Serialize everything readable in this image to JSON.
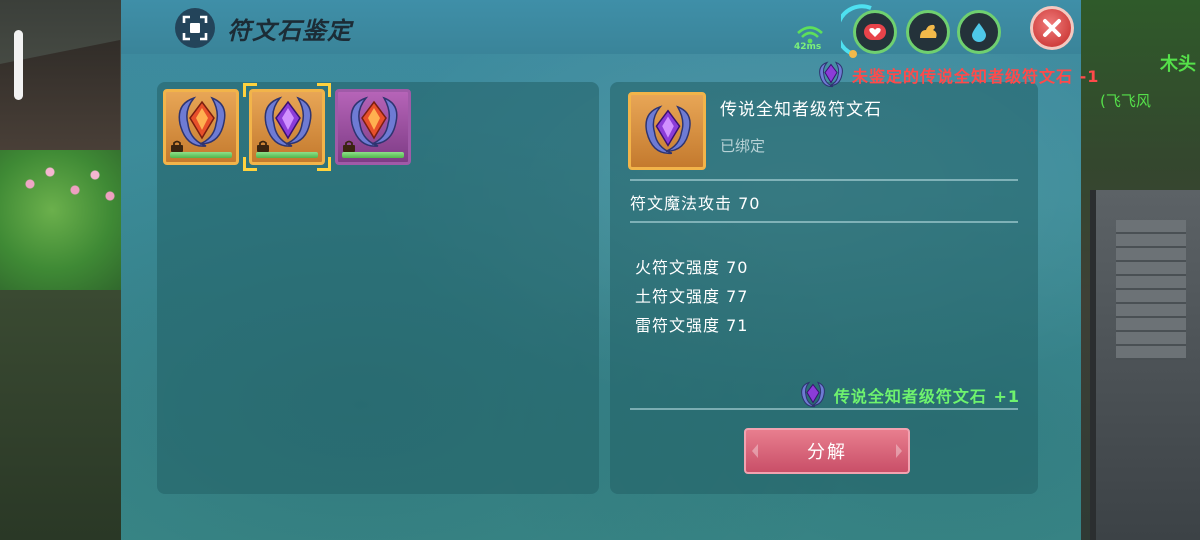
{
  "window": {
    "title": "符文石鉴定",
    "title_icon": "scan-frame-icon"
  },
  "hud": {
    "ping": "42ms",
    "signal_icon": "wifi-signal-icon",
    "buttons": [
      {
        "icon": "heart-icon",
        "color": "#e8434a"
      },
      {
        "icon": "strength-arm-icon",
        "color": "#f2b94a"
      },
      {
        "icon": "water-drop-icon",
        "color": "#4ec8e8"
      }
    ],
    "close_icon": "close-icon"
  },
  "notification": {
    "text": "未鉴定的传说全知者级符文石 -1",
    "icon": "rune-stone-icon"
  },
  "world": {
    "text_1": "木头",
    "text_2": "(飞飞风"
  },
  "inventory": {
    "slots": [
      {
        "rarity": "gold",
        "gem_color": "#e8502a",
        "locked": true,
        "selected": false
      },
      {
        "rarity": "gold",
        "gem_color": "#8c3cd8",
        "locked": true,
        "selected": true
      },
      {
        "rarity": "purple",
        "gem_color": "#e8502a",
        "locked": true,
        "selected": false
      }
    ]
  },
  "detail": {
    "item_name": "传说全知者级符文石",
    "bound_status": "已绑定",
    "main_stat": "符文魔法攻击 70",
    "sub_stats": [
      "火符文强度 70",
      "土符文强度 77",
      "雷符文强度 71"
    ],
    "reward_text": "传说全知者级符文石 +1",
    "decompose_label": "分解"
  },
  "colors": {
    "panel": "#3c8c98",
    "accent_gold": "#f2b44a",
    "accent_purple": "#a05aa8",
    "reward_green": "#6ef36e",
    "notify_red": "#ff4a4a",
    "button_pink": "#c94f68"
  }
}
